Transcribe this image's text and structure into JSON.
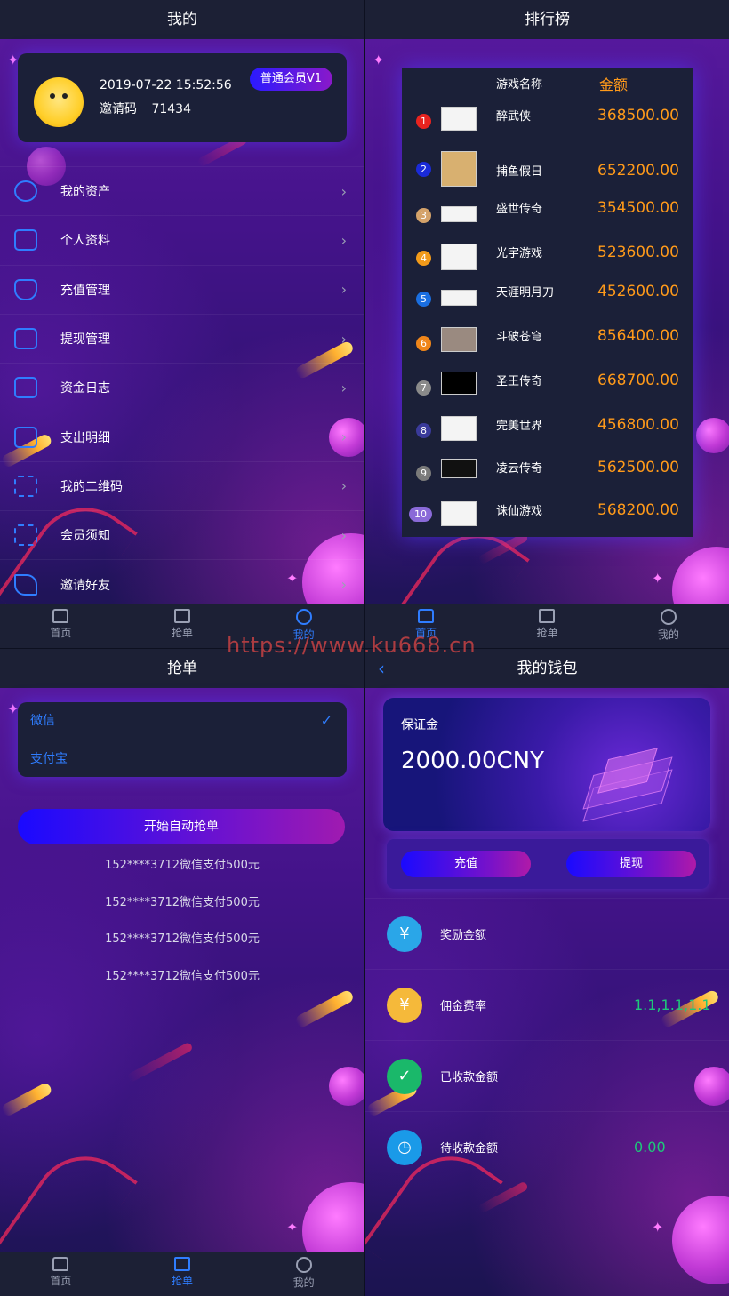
{
  "colors": {
    "accent": "#2f7dff",
    "amount": "#ff9a1a",
    "green": "#1ec97a",
    "bar": "#1c2035"
  },
  "profile": {
    "title": "我的",
    "datetime": "2019-07-22 15:52:56",
    "invite_label": "邀请码",
    "invite_code": "71434",
    "badge": "普通会员V1",
    "menu": [
      {
        "label": "我的资产",
        "icon": "coins-icon"
      },
      {
        "label": "个人资料",
        "icon": "document-icon"
      },
      {
        "label": "充值管理",
        "icon": "yuan-shield-icon"
      },
      {
        "label": "提现管理",
        "icon": "cash-icon"
      },
      {
        "label": "资金日志",
        "icon": "cash-icon"
      },
      {
        "label": "支出明细",
        "icon": "cash-icon"
      },
      {
        "label": "我的二维码",
        "icon": "qrcode-icon"
      },
      {
        "label": "会员须知",
        "icon": "qrcode-icon"
      },
      {
        "label": "邀请好友",
        "icon": "paper-plane-icon"
      }
    ]
  },
  "tabs": [
    {
      "label": "首页",
      "icon": "home-icon"
    },
    {
      "label": "抢单",
      "icon": "mail-icon"
    },
    {
      "label": "我的",
      "icon": "user-icon"
    }
  ],
  "ranking": {
    "title": "排行榜",
    "col_name": "游戏名称",
    "col_amount": "金额",
    "rows": [
      {
        "rank": "1",
        "name": "醉武侠",
        "amount": "368500.00",
        "color": "#e8231f"
      },
      {
        "rank": "2",
        "name": "捕鱼假日",
        "amount": "652200.00",
        "color": "#1a2ad8"
      },
      {
        "rank": "3",
        "name": "盛世传奇",
        "amount": "354500.00",
        "color": "#d4a26a"
      },
      {
        "rank": "4",
        "name": "光宇游戏",
        "amount": "523600.00",
        "color": "#f29a1a"
      },
      {
        "rank": "5",
        "name": "天涯明月刀",
        "amount": "452600.00",
        "color": "#1a6ee0"
      },
      {
        "rank": "6",
        "name": "斗破苍穹",
        "amount": "856400.00",
        "color": "#f0861a"
      },
      {
        "rank": "7",
        "name": "圣王传奇",
        "amount": "668700.00",
        "color": "#8a8a8a"
      },
      {
        "rank": "8",
        "name": "完美世界",
        "amount": "456800.00",
        "color": "#3a3a9a"
      },
      {
        "rank": "9",
        "name": "凌云传奇",
        "amount": "562500.00",
        "color": "#7a7a7a"
      },
      {
        "rank": "10",
        "name": "诛仙游戏",
        "amount": "568200.00",
        "color": "#8a6ad8"
      }
    ]
  },
  "grab": {
    "title": "抢单",
    "options": [
      "微信",
      "支付宝"
    ],
    "start_button": "开始自动抢单",
    "orders": [
      "152****3712微信支付500元",
      "152****3712微信支付500元",
      "152****3712微信支付500元",
      "152****3712微信支付500元"
    ]
  },
  "wallet": {
    "title": "我的钱包",
    "back": "‹",
    "deposit_label": "保证金",
    "deposit_amount": "2000.00CNY",
    "recharge": "充值",
    "withdraw": "提现",
    "items": [
      {
        "label": "奖励金额",
        "value": "",
        "icon": "yuan-shield-icon",
        "color": "#2aa6e8"
      },
      {
        "label": "佣金费率",
        "value": "1.1,1.1,1.1",
        "icon": "money-bag-icon",
        "color": "#f5b93a"
      },
      {
        "label": "已收款金额",
        "value": "",
        "icon": "checkmark-icon",
        "color": "#1ab86a"
      },
      {
        "label": "待收款金额",
        "value": "0.00",
        "icon": "clock-icon",
        "color": "#1a9ae8"
      }
    ]
  },
  "watermark": "https://www.ku668.cn"
}
